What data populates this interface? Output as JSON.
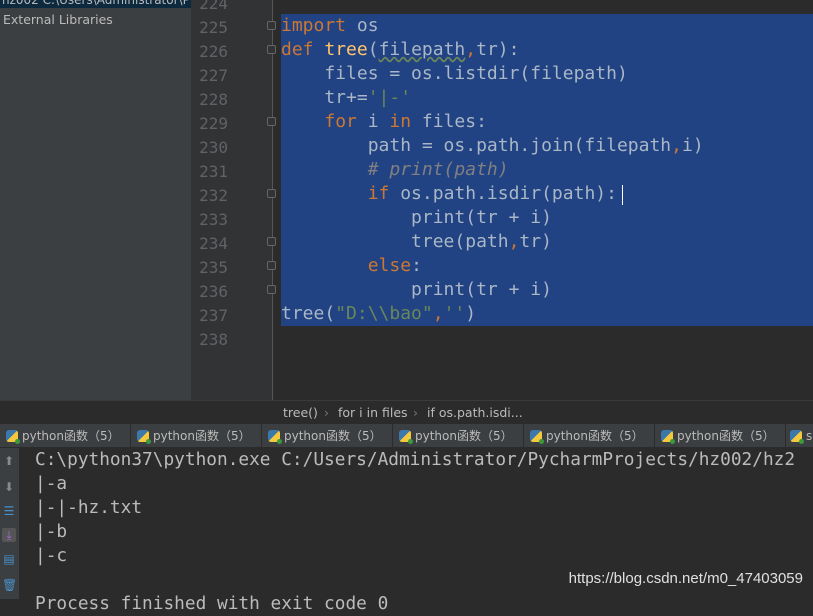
{
  "sidebar": {
    "project_row": "hz002  C:\\Users\\Administrator\\P",
    "items": [
      {
        "label": "External Libraries"
      }
    ]
  },
  "editor": {
    "line_numbers": [
      "224",
      "225",
      "226",
      "227",
      "228",
      "229",
      "230",
      "231",
      "232",
      "233",
      "234",
      "235",
      "236",
      "237",
      "238"
    ],
    "fold_lines": [
      "225",
      "226",
      "229",
      "232",
      "234",
      "235",
      "236"
    ],
    "code_lines": [
      [],
      [
        {
          "t": "import",
          "c": "kw"
        },
        {
          "t": " os"
        }
      ],
      [
        {
          "t": "def ",
          "c": "kw"
        },
        {
          "t": "tree",
          "c": "fn"
        },
        {
          "t": "("
        },
        {
          "t": "filepath",
          "c": "wavy"
        },
        {
          "t": ",",
          "c": "kw"
        },
        {
          "t": "tr):"
        }
      ],
      [
        {
          "t": "    files = os.listdir(filepath)"
        }
      ],
      [
        {
          "t": "    tr+="
        },
        {
          "t": "'|-'",
          "c": "str"
        }
      ],
      [
        {
          "t": "    "
        },
        {
          "t": "for ",
          "c": "kw"
        },
        {
          "t": "i "
        },
        {
          "t": "in ",
          "c": "kw"
        },
        {
          "t": "files:"
        }
      ],
      [
        {
          "t": "        path = os.path.join(filepath"
        },
        {
          "t": ",",
          "c": "kw"
        },
        {
          "t": "i)"
        }
      ],
      [
        {
          "t": "        "
        },
        {
          "t": "# print(path)",
          "c": "com"
        }
      ],
      [
        {
          "t": "        "
        },
        {
          "t": "if ",
          "c": "kw"
        },
        {
          "t": "os.path.isdir(path):"
        }
      ],
      [
        {
          "t": "            print(tr + i)"
        }
      ],
      [
        {
          "t": "            tree(path"
        },
        {
          "t": ",",
          "c": "kw"
        },
        {
          "t": "tr)"
        }
      ],
      [
        {
          "t": "        "
        },
        {
          "t": "else",
          "c": "kw"
        },
        {
          "t": ":"
        }
      ],
      [
        {
          "t": "            print(tr + i)"
        }
      ],
      [
        {
          "t": "tree("
        },
        {
          "t": "\"D:\\\\bao\"",
          "c": "str"
        },
        {
          "t": ",",
          "c": "kw"
        },
        {
          "t": "''",
          "c": "str"
        },
        {
          "t": ")"
        }
      ],
      []
    ]
  },
  "breadcrumbs": [
    "tree()",
    "for i in files",
    "if os.path.isdi..."
  ],
  "tabs": [
    "python函数（5）",
    "python函数（5）",
    "python函数（5）",
    "python函数（5）",
    "python函数（5）",
    "python函数（5）",
    "s"
  ],
  "console": {
    "lines": [
      "C:\\python37\\python.exe C:/Users/Administrator/PycharmProjects/hz002/hz2",
      "|-a",
      "|-|-hz.txt",
      "|-b",
      "|-c",
      "",
      "Process finished with exit code 0"
    ]
  },
  "watermark": "https://blog.csdn.net/m0_47403059",
  "colors": {
    "selection": "#214283",
    "keyword": "#cc7832",
    "string": "#6a8759",
    "comment": "#808080"
  }
}
